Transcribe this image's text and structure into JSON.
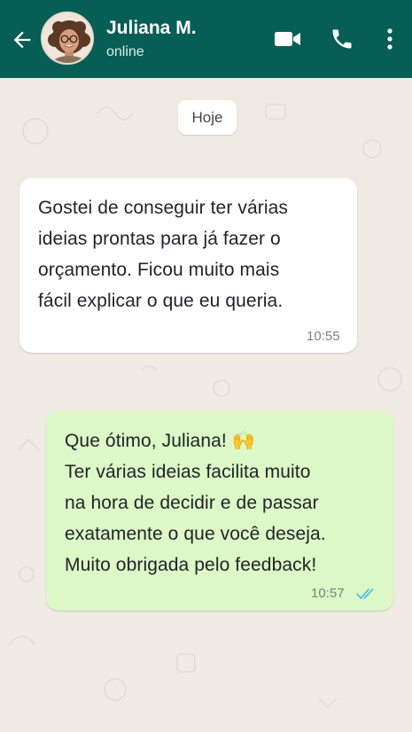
{
  "header": {
    "contact_name": "Juliana M.",
    "status": "online",
    "background_color": "#075e54"
  },
  "icons": {
    "back": "arrow-back-icon",
    "video": "video-call-icon",
    "phone": "voice-call-icon",
    "menu": "more-vert-icon",
    "read": "double-check-icon"
  },
  "chat": {
    "date_label": "Hoje",
    "messages": [
      {
        "direction": "incoming",
        "lines": [
          "Gostei de conseguir ter várias",
          "ideias prontas para já fazer o",
          "orçamento. Ficou muito mais",
          "fácil explicar o que eu queria."
        ],
        "time": "10:55"
      },
      {
        "direction": "outgoing",
        "lines": [
          "Que ótimo, Juliana! 🙌",
          "Ter várias ideias facilita muito",
          "na hora de decidir e de passar",
          "exatamente o que você deseja.",
          "Muito obrigada pelo feedback!"
        ],
        "time": "10:57",
        "read": true
      }
    ]
  },
  "colors": {
    "incoming_bubble": "#ffffff",
    "outgoing_bubble": "#dcf8c6",
    "read_ticks": "#53bdeb",
    "wallpaper": "#efeae2"
  }
}
